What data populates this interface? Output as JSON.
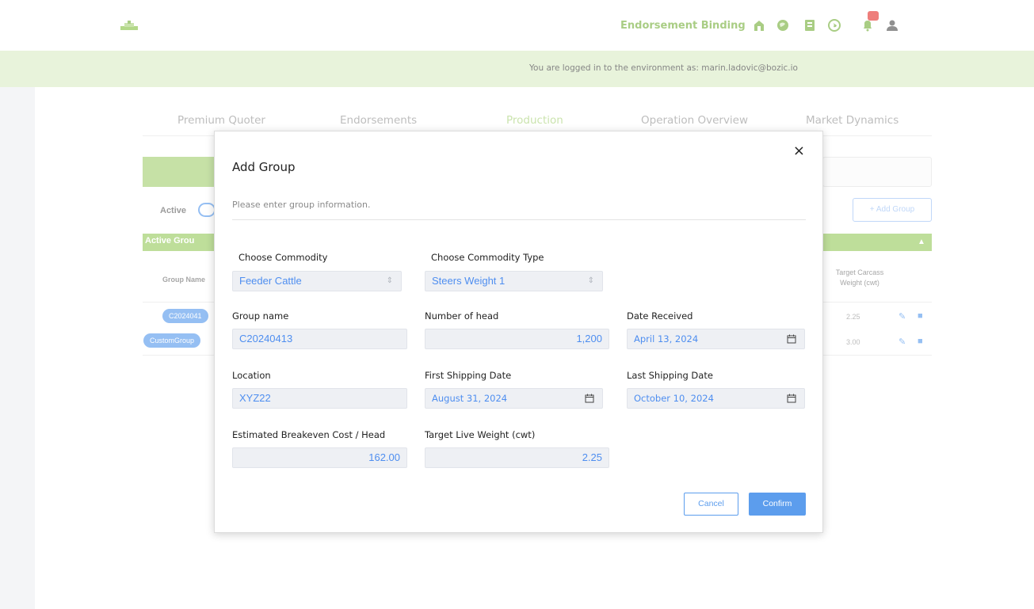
{
  "header": {
    "brand_link": "Endorsement Binding",
    "icons": [
      "barn-icon",
      "globe-icon",
      "book-icon",
      "world-icon",
      "bell-icon",
      "user-icon"
    ],
    "accent": "#7cb342"
  },
  "banner": {
    "text": "You are logged in to the environment as: marin.ladovic@bozic.io"
  },
  "tabs": [
    {
      "label": "Premium Quoter"
    },
    {
      "label": "Endorsements"
    },
    {
      "label": "Production"
    },
    {
      "label": "Operation Overview"
    },
    {
      "label": "Market Dynamics"
    }
  ],
  "background": {
    "active_label": "Active",
    "add_group": "+ Add Group",
    "active_groups": "Active Grou",
    "col_group_name": "Group Name",
    "col_target_carcass": "Target Carcass Weight (cwt)",
    "rows": [
      {
        "pill": "C2024041",
        "value": "2.25"
      },
      {
        "pill": "CustomGroup",
        "value": "3.00"
      }
    ]
  },
  "modal": {
    "title": "Add Group",
    "subtitle": "Please enter group information.",
    "close": "×",
    "fields": {
      "commodity": {
        "label": "Choose Commodity",
        "value": "Feeder Cattle"
      },
      "commodity_type": {
        "label": "Choose Commodity Type",
        "value": "Steers Weight 1"
      },
      "group_name": {
        "label": "Group name",
        "value": "C20240413"
      },
      "number_of_head": {
        "label": "Number of head",
        "value": "1,200"
      },
      "date_received": {
        "label": "Date Received",
        "value": "April 13, 2024"
      },
      "location": {
        "label": "Location",
        "value": "XYZ22"
      },
      "first_shipping": {
        "label": "First Shipping Date",
        "value": "August 31, 2024"
      },
      "last_shipping": {
        "label": "Last Shipping Date",
        "value": "October 10, 2024"
      },
      "breakeven": {
        "label": "Estimated Breakeven Cost / Head",
        "value": "162.00"
      },
      "target_live_weight": {
        "label": "Target Live Weight (cwt)",
        "value": "2.25"
      }
    },
    "cancel": "Cancel",
    "confirm": "Confirm"
  },
  "colors": {
    "primary": "#5c9ded",
    "green": "#8bc34a",
    "banner": "#dcedc8"
  }
}
